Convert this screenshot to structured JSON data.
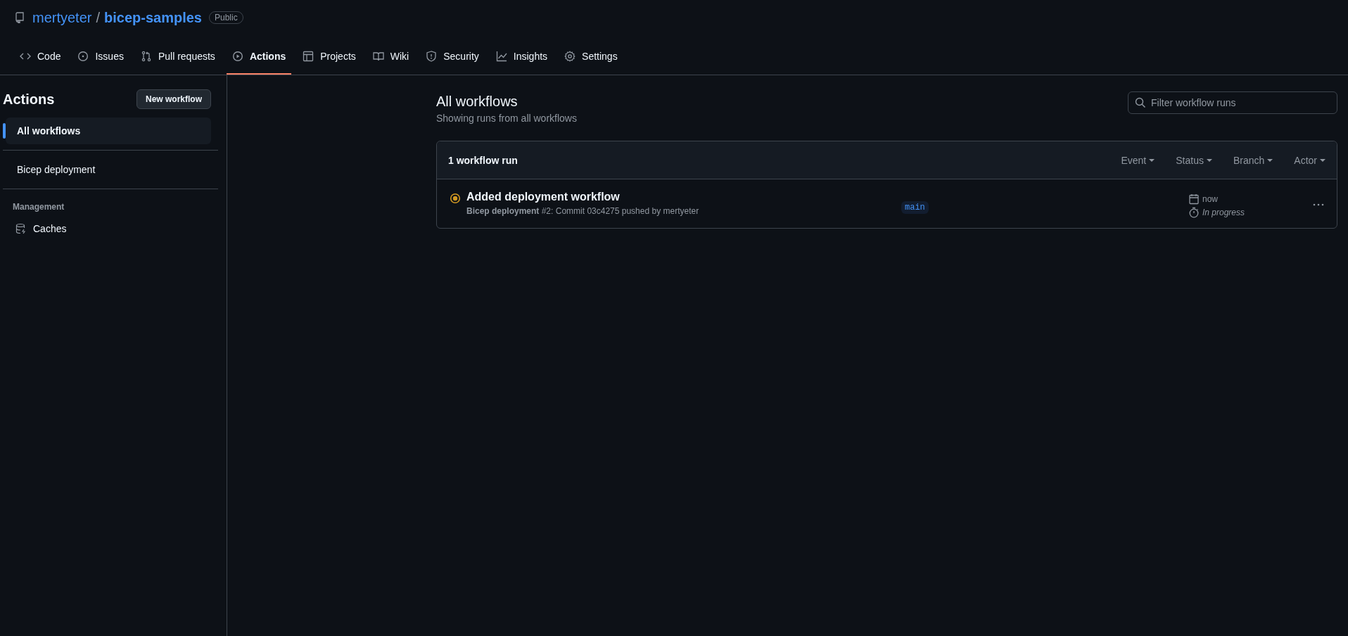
{
  "repo": {
    "owner": "mertyeter",
    "separator": "/",
    "name": "bicep-samples",
    "visibility": "Public"
  },
  "tabs": [
    {
      "label": "Code",
      "kind": "code",
      "selected": false
    },
    {
      "label": "Issues",
      "kind": "issue",
      "selected": false
    },
    {
      "label": "Pull requests",
      "kind": "pr",
      "selected": false
    },
    {
      "label": "Actions",
      "kind": "play",
      "selected": true
    },
    {
      "label": "Projects",
      "kind": "table",
      "selected": false
    },
    {
      "label": "Wiki",
      "kind": "book",
      "selected": false
    },
    {
      "label": "Security",
      "kind": "shield",
      "selected": false
    },
    {
      "label": "Insights",
      "kind": "graph",
      "selected": false
    },
    {
      "label": "Settings",
      "kind": "gear",
      "selected": false
    }
  ],
  "sidebar": {
    "title": "Actions",
    "new_button": "New workflow",
    "items": [
      {
        "label": "All workflows",
        "selected": true
      },
      {
        "label": "Bicep deployment",
        "selected": false
      }
    ],
    "section": "Management",
    "management_items": [
      {
        "label": "Caches"
      }
    ]
  },
  "main": {
    "title": "All workflows",
    "subtitle": "Showing runs from all workflows",
    "search": {
      "placeholder": "Filter workflow runs"
    },
    "table": {
      "count": "1 workflow run",
      "filters": [
        "Event",
        "Status",
        "Branch",
        "Actor"
      ],
      "rows": [
        {
          "kind": "running",
          "title": "Added deployment workflow",
          "detail": "**Bicep deployment** #2: Commit 03c4275 pushed by mertyeter",
          "branch": "main",
          "time": "now",
          "duration": "In progress"
        }
      ]
    }
  }
}
